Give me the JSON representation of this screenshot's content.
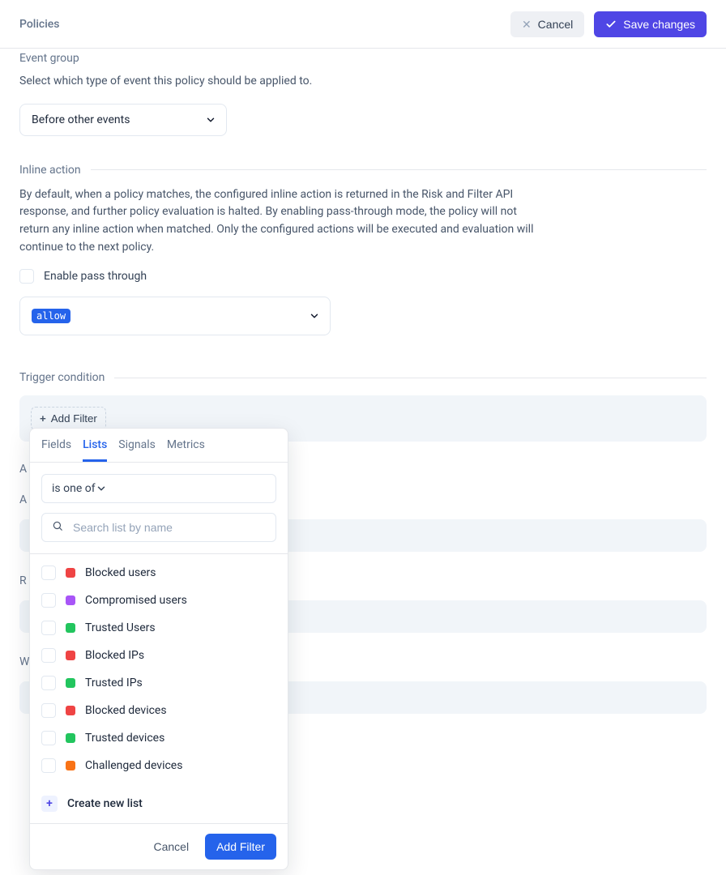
{
  "header": {
    "title": "Policies",
    "cancel": "Cancel",
    "save": "Save changes"
  },
  "event_group": {
    "label": "Event group",
    "desc": "Select which type of event this policy should be applied to.",
    "selected": "Before other events"
  },
  "inline_action": {
    "label": "Inline action",
    "desc": "By default, when a policy matches, the configured inline action is returned in the Risk and Filter API response, and further policy evaluation is halted. By enabling pass-through mode, the policy will not return any inline action when matched. Only the configured actions will be executed and evaluation will continue to the next policy.",
    "checkbox_label": "Enable pass through",
    "allow_tag": "allow"
  },
  "trigger": {
    "label": "Trigger condition",
    "add_filter": "Add Filter"
  },
  "obscured": {
    "a": "A",
    "a2": "A",
    "r": "R",
    "w": "W"
  },
  "popover": {
    "tabs": [
      "Fields",
      "Lists",
      "Signals",
      "Metrics"
    ],
    "active_tab_index": 1,
    "operator": "is one of",
    "search_placeholder": "Search list by name",
    "items": [
      {
        "label": "Blocked users",
        "color": "#ef4444"
      },
      {
        "label": "Compromised users",
        "color": "#a855f7"
      },
      {
        "label": "Trusted Users",
        "color": "#22c55e"
      },
      {
        "label": "Blocked IPs",
        "color": "#ef4444"
      },
      {
        "label": "Trusted IPs",
        "color": "#22c55e"
      },
      {
        "label": "Blocked devices",
        "color": "#ef4444"
      },
      {
        "label": "Trusted devices",
        "color": "#22c55e"
      },
      {
        "label": "Challenged devices",
        "color": "#f97316"
      }
    ],
    "create_new": "Create new list",
    "cancel": "Cancel",
    "add_filter": "Add Filter"
  }
}
